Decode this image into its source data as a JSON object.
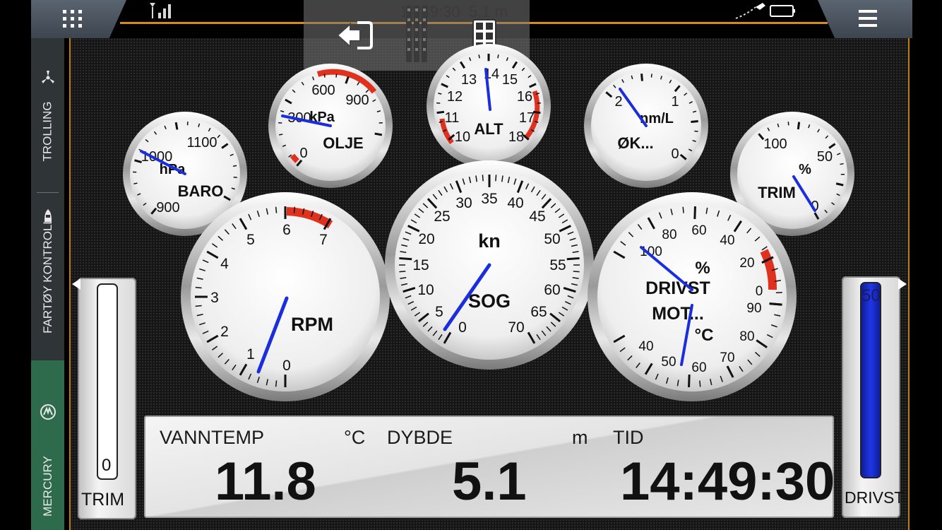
{
  "topbar": {
    "clock": "14:49:30",
    "depth": "5.1 m"
  },
  "sidebar": {
    "items": [
      {
        "label": "TROLLING",
        "icon": "propeller-icon",
        "active": false
      },
      {
        "label": "FARTØY KONTROLL",
        "icon": "boat-icon",
        "active": false
      },
      {
        "label": "MERCURY",
        "icon": "mercury-logo-icon",
        "active": true
      }
    ]
  },
  "gauges": {
    "baro": {
      "label": "BARO",
      "unit": "hPa",
      "ticks": [
        "900",
        "1000",
        "1100"
      ],
      "value": 1000
    },
    "olje": {
      "label": "OLJE",
      "unit": "kPa",
      "ticks": [
        "0",
        "300",
        "600",
        "900"
      ],
      "value": 300
    },
    "alt": {
      "label": "ALT",
      "ticks": [
        "10",
        "11",
        "12",
        "13",
        "14",
        "15",
        "16",
        "17",
        "18"
      ],
      "value": 14
    },
    "oek": {
      "label": "ØK...",
      "unit": "nm/L",
      "ticks": [
        "2",
        "1",
        "0"
      ],
      "value": 2
    },
    "trim": {
      "label": "TRIM",
      "unit": "%",
      "ticks": [
        "100",
        "50",
        "0"
      ],
      "value": 0
    },
    "rpm": {
      "label": "RPM",
      "ticks": [
        "0",
        "1",
        "2",
        "3",
        "4",
        "5",
        "6",
        "7"
      ],
      "value": 0
    },
    "sog": {
      "label": "SOG",
      "unit": "kn",
      "ticks": [
        "0",
        "5",
        "10",
        "15",
        "20",
        "25",
        "30",
        "35",
        "40",
        "45",
        "50",
        "55",
        "60",
        "65",
        "70"
      ],
      "value": 0
    },
    "drivst": {
      "label_top": "DRIVST",
      "label_bottom": "MOT...",
      "unit_top": "%",
      "unit_bottom": "°C",
      "ticks_top": [
        "100",
        "80",
        "60",
        "40",
        "20",
        "0"
      ],
      "ticks_bottom": [
        "40",
        "50",
        "60",
        "70",
        "80",
        "90"
      ],
      "value_top": 100,
      "value_bottom": 50
    }
  },
  "bars": {
    "trim": {
      "label": "TRIM",
      "value": "0",
      "fill_fraction": 0.0
    },
    "drivst": {
      "label": "DRIVST",
      "value": "50",
      "fill_fraction": 1.0
    }
  },
  "databar": {
    "vanntemp": {
      "label": "VANNTEMP",
      "unit": "°C",
      "value": "11.8"
    },
    "dybde": {
      "label": "DYBDE",
      "unit": "m",
      "value": "5.1"
    },
    "tid": {
      "label": "TID",
      "value": "14:49:30"
    }
  },
  "colors": {
    "accent": "#d68a24",
    "needle": "#1a2ee0",
    "redzone": "#e0301e",
    "sidebar_active": "#2e6b4d"
  }
}
